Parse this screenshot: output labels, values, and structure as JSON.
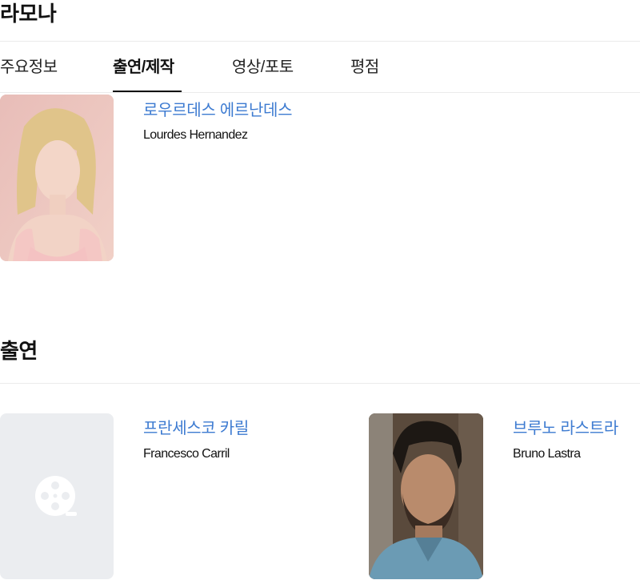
{
  "page": {
    "title": "라모나"
  },
  "tabs": [
    {
      "label": "주요정보",
      "active": false
    },
    {
      "label": "출연/제작",
      "active": true
    },
    {
      "label": "영상/포토",
      "active": false
    },
    {
      "label": "평점",
      "active": false
    }
  ],
  "director": {
    "name_ko": "로우르데스 에르난데스",
    "name_en": "Lourdes Hernandez",
    "photo_icon": "portrait-photo"
  },
  "cast_section": {
    "title": "출연",
    "people": [
      {
        "name_ko": "프란세스코 카릴",
        "name_en": "Francesco Carril",
        "photo_icon": "film-reel-placeholder-icon"
      },
      {
        "name_ko": "브루노 라스트라",
        "name_en": "Bruno Lastra",
        "photo_icon": "portrait-photo"
      }
    ]
  },
  "colors": {
    "link": "#3d7bd1",
    "placeholder_bg": "#ebedf0",
    "divider": "#ebebeb"
  }
}
